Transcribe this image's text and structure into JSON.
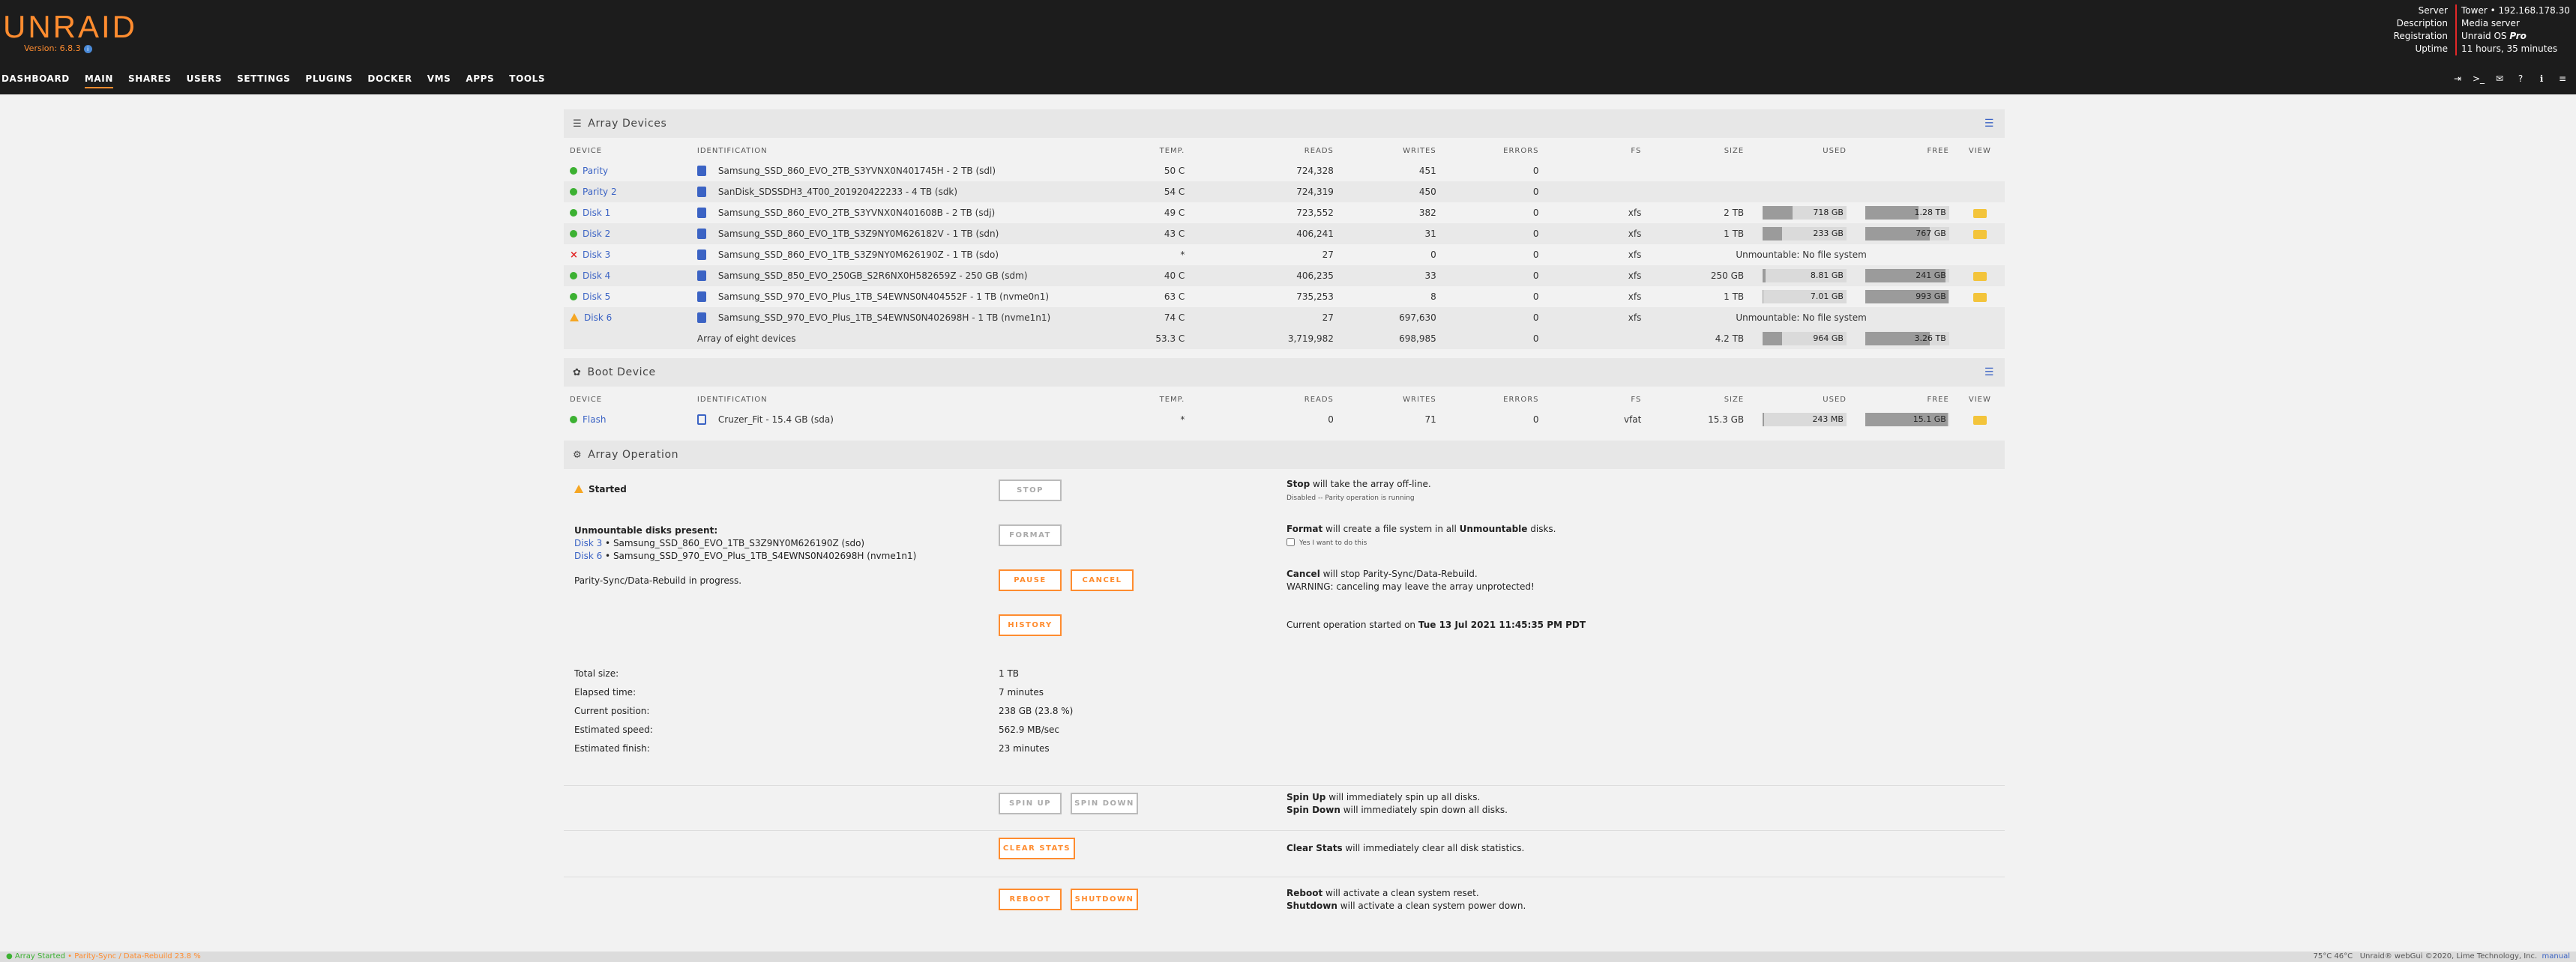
{
  "brand": {
    "logo": "UNRAID",
    "version": "Version: 6.8.3",
    "accent": "#ff8c2f"
  },
  "server_info": [
    {
      "k": "Server",
      "v": "Tower • 192.168.178.30"
    },
    {
      "k": "Description",
      "v": "Media server"
    },
    {
      "k": "Registration",
      "v": "Unraid OS ",
      "vi": "Pro"
    },
    {
      "k": "Uptime",
      "v": "11 hours, 35 minutes"
    }
  ],
  "nav": [
    "DASHBOARD",
    "MAIN",
    "SHARES",
    "USERS",
    "SETTINGS",
    "PLUGINS",
    "DOCKER",
    "VMS",
    "APPS",
    "TOOLS"
  ],
  "nav_active": "MAIN",
  "nav_icons": [
    "logout-icon",
    "terminal-icon",
    "feedback-icon",
    "help-icon",
    "info-icon",
    "log-icon"
  ],
  "array": {
    "title": "Array Devices",
    "headers": [
      "DEVICE",
      "IDENTIFICATION",
      "TEMP.",
      "READS",
      "WRITES",
      "ERRORS",
      "FS",
      "SIZE",
      "USED",
      "FREE",
      "VIEW"
    ],
    "rows": [
      {
        "status": "ok",
        "dev": "Parity",
        "id": "Samsung_SSD_860_EVO_2TB_S3YVNX0N401745H - 2 TB (sdl)",
        "temp": "50 C",
        "reads": "724,328",
        "writes": "451",
        "errors": "0",
        "fs": "",
        "size": "",
        "used": "",
        "used_pct": 0,
        "free": "",
        "view": false
      },
      {
        "status": "ok",
        "dev": "Parity 2",
        "id": "SanDisk_SDSSDH3_4T00_201920422233 - 4 TB (sdk)",
        "temp": "54 C",
        "reads": "724,319",
        "writes": "450",
        "errors": "0",
        "fs": "",
        "size": "",
        "used": "",
        "used_pct": 0,
        "free": "",
        "view": false
      },
      {
        "status": "ok",
        "dev": "Disk 1",
        "id": "Samsung_SSD_860_EVO_2TB_S3YVNX0N401608B - 2 TB (sdj)",
        "temp": "49 C",
        "reads": "723,552",
        "writes": "382",
        "errors": "0",
        "fs": "xfs",
        "size": "2 TB",
        "used": "718 GB",
        "used_pct": 36,
        "free": "1.28 TB",
        "free_pct": 64,
        "view": true
      },
      {
        "status": "ok",
        "dev": "Disk 2",
        "id": "Samsung_SSD_860_EVO_1TB_S3Z9NY0M626182V - 1 TB (sdn)",
        "temp": "43 C",
        "reads": "406,241",
        "writes": "31",
        "errors": "0",
        "fs": "xfs",
        "size": "1 TB",
        "used": "233 GB",
        "used_pct": 23,
        "free": "767 GB",
        "free_pct": 77,
        "view": true
      },
      {
        "status": "err",
        "dev": "Disk 3",
        "id": "Samsung_SSD_860_EVO_1TB_S3Z9NY0M626190Z - 1 TB (sdo)",
        "temp": "*",
        "reads": "27",
        "writes": "0",
        "errors": "0",
        "fs": "xfs",
        "unmountable": "Unmountable: No file system",
        "view": false
      },
      {
        "status": "ok",
        "dev": "Disk 4",
        "id": "Samsung_SSD_850_EVO_250GB_S2R6NX0H582659Z - 250 GB (sdm)",
        "mon": true,
        "temp": "40 C",
        "reads": "406,235",
        "writes": "33",
        "errors": "0",
        "fs": "xfs",
        "size": "250 GB",
        "used": "8.81 GB",
        "used_pct": 4,
        "free": "241 GB",
        "free_pct": 96,
        "view": true
      },
      {
        "status": "ok",
        "dev": "Disk 5",
        "id": "Samsung_SSD_970_EVO_Plus_1TB_S4EWNS0N404552F - 1 TB (nvme0n1)",
        "temp": "63 C",
        "reads": "735,253",
        "writes": "8",
        "errors": "0",
        "fs": "xfs",
        "size": "1 TB",
        "used": "7.01 GB",
        "used_pct": 1,
        "free": "993 GB",
        "free_pct": 99,
        "view": true
      },
      {
        "status": "warn",
        "dev": "Disk 6",
        "id": "Samsung_SSD_970_EVO_Plus_1TB_S4EWNS0N402698H - 1 TB (nvme1n1)",
        "temp": "74 C",
        "reads": "27",
        "writes": "697,630",
        "errors": "0",
        "fs": "xfs",
        "unmountable": "Unmountable: No file system",
        "view": false
      }
    ],
    "total": {
      "label": "Array of eight devices",
      "temp": "53.3 C",
      "reads": "3,719,982",
      "writes": "698,985",
      "errors": "0",
      "size": "4.2 TB",
      "used": "964 GB",
      "used_pct": 23,
      "free": "3.26 TB",
      "free_pct": 77
    }
  },
  "boot": {
    "title": "Boot Device",
    "headers": [
      "DEVICE",
      "IDENTIFICATION",
      "TEMP.",
      "READS",
      "WRITES",
      "ERRORS",
      "FS",
      "SIZE",
      "USED",
      "FREE",
      "VIEW"
    ],
    "rows": [
      {
        "status": "ok",
        "dev": "Flash",
        "id": "Cruzer_Fit - 15.4 GB (sda)",
        "temp": "*",
        "reads": "0",
        "writes": "71",
        "errors": "0",
        "fs": "vfat",
        "size": "15.3 GB",
        "used": "243 MB",
        "used_pct": 2,
        "free": "15.1 GB",
        "free_pct": 98,
        "view": true
      }
    ]
  },
  "operation": {
    "title": "Array Operation",
    "status": "Started",
    "stop_label": "STOP",
    "stop_desc_b": "Stop",
    "stop_desc": " will take the array off-line.",
    "stop_note": "Disabled -- Parity operation is running",
    "unmountable_heading": "Unmountable disks present:",
    "unmountable": [
      {
        "dev": "Disk 3",
        "desc": " • Samsung_SSD_860_EVO_1TB_S3Z9NY0M626190Z (sdo)"
      },
      {
        "dev": "Disk 6",
        "desc": " • Samsung_SSD_970_EVO_Plus_1TB_S4EWNS0N402698H (nvme1n1)"
      }
    ],
    "format_label": "FORMAT",
    "format_desc_b1": "Format",
    "format_desc_1": " will create a file system in all ",
    "format_desc_b2": "Unmountable",
    "format_desc_2": " disks.",
    "format_confirm": "Yes I want to do this",
    "sync_text": "Parity-Sync/Data-Rebuild in progress.",
    "pause_label": "PAUSE",
    "cancel_label": "CANCEL",
    "cancel_desc_b": "Cancel",
    "cancel_desc": " will stop Parity-Sync/Data-Rebuild.",
    "cancel_warn": "WARNING: canceling may leave the array unprotected!",
    "history_label": "HISTORY",
    "started_desc": "Current operation started on ",
    "started_date": "Tue 13 Jul 2021 11:45:35 PM PDT",
    "stats": [
      {
        "k": "Total size:",
        "v": "1 TB"
      },
      {
        "k": "Elapsed time:",
        "v": "7 minutes"
      },
      {
        "k": "Current position:",
        "v": "238 GB (23.8 %)"
      },
      {
        "k": "Estimated speed:",
        "v": "562.9 MB/sec"
      },
      {
        "k": "Estimated finish:",
        "v": "23 minutes"
      }
    ],
    "spinup_label": "SPIN UP",
    "spindown_label": "SPIN DOWN",
    "spinup_desc_b": "Spin Up",
    "spinup_desc": " will immediately spin up all disks.",
    "spindown_desc_b": "Spin Down",
    "spindown_desc": " will immediately spin down all disks.",
    "clear_label": "CLEAR STATS",
    "clear_desc_b": "Clear Stats",
    "clear_desc": " will immediately clear all disk statistics.",
    "reboot_label": "REBOOT",
    "shutdown_label": "SHUTDOWN",
    "reboot_desc_b": "Reboot",
    "reboot_desc": " will activate a clean system reset.",
    "shutdown_desc_b": "Shutdown",
    "shutdown_desc": " will activate a clean system power down."
  },
  "footer": {
    "status": "Array Started",
    "progress": " • Parity-Sync / Data-Rebuild 23.8 %",
    "temps": "75°C   46°C",
    "copyright": "Unraid® webGui ©2020, Lime Technology, Inc.",
    "manual": "manual"
  }
}
